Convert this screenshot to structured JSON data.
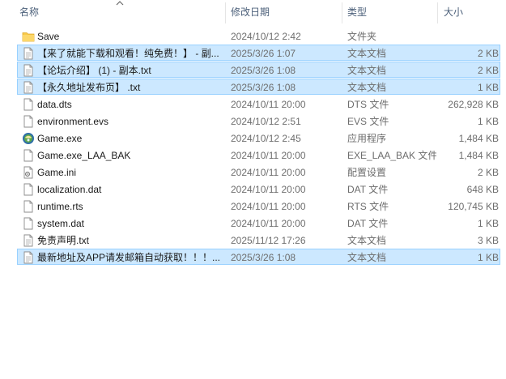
{
  "columns": {
    "name": "名称",
    "date": "修改日期",
    "type": "类型",
    "size": "大小"
  },
  "files": [
    {
      "name": "Save",
      "date": "2024/10/12 2:42",
      "type": "文件夹",
      "size": "",
      "icon": "folder-icon",
      "selected": false
    },
    {
      "name": "【来了就能下载和观看！纯免费！】 - 副...",
      "date": "2025/3/26 1:07",
      "type": "文本文档",
      "size": "2 KB",
      "icon": "text-file-icon",
      "selected": true
    },
    {
      "name": "【论坛介绍】 (1) - 副本.txt",
      "date": "2025/3/26 1:08",
      "type": "文本文档",
      "size": "2 KB",
      "icon": "text-file-icon",
      "selected": true
    },
    {
      "name": "【永久地址发布页】 .txt",
      "date": "2025/3/26 1:08",
      "type": "文本文档",
      "size": "1 KB",
      "icon": "text-file-icon",
      "selected": true
    },
    {
      "name": "data.dts",
      "date": "2024/10/11 20:00",
      "type": "DTS 文件",
      "size": "262,928 KB",
      "icon": "file-icon",
      "selected": false
    },
    {
      "name": "environment.evs",
      "date": "2024/10/12 2:51",
      "type": "EVS 文件",
      "size": "1 KB",
      "icon": "file-icon",
      "selected": false
    },
    {
      "name": "Game.exe",
      "date": "2024/10/12 2:45",
      "type": "应用程序",
      "size": "1,484 KB",
      "icon": "game-exe-icon",
      "selected": false
    },
    {
      "name": "Game.exe_LAA_BAK",
      "date": "2024/10/11 20:00",
      "type": "EXE_LAA_BAK 文件",
      "size": "1,484 KB",
      "icon": "file-icon",
      "selected": false
    },
    {
      "name": "Game.ini",
      "date": "2024/10/11 20:00",
      "type": "配置设置",
      "size": "2 KB",
      "icon": "settings-file-icon",
      "selected": false
    },
    {
      "name": "localization.dat",
      "date": "2024/10/11 20:00",
      "type": "DAT 文件",
      "size": "648 KB",
      "icon": "file-icon",
      "selected": false
    },
    {
      "name": "runtime.rts",
      "date": "2024/10/11 20:00",
      "type": "RTS 文件",
      "size": "120,745 KB",
      "icon": "file-icon",
      "selected": false
    },
    {
      "name": "system.dat",
      "date": "2024/10/11 20:00",
      "type": "DAT 文件",
      "size": "1 KB",
      "icon": "file-icon",
      "selected": false
    },
    {
      "name": "免责声明.txt",
      "date": "2025/11/12 17:26",
      "type": "文本文档",
      "size": "3 KB",
      "icon": "text-file-icon",
      "selected": false
    },
    {
      "name": "最新地址及APP请发邮箱自动获取！！！...",
      "date": "2025/3/26 1:08",
      "type": "文本文档",
      "size": "1 KB",
      "icon": "text-file-icon",
      "selected": true
    }
  ]
}
